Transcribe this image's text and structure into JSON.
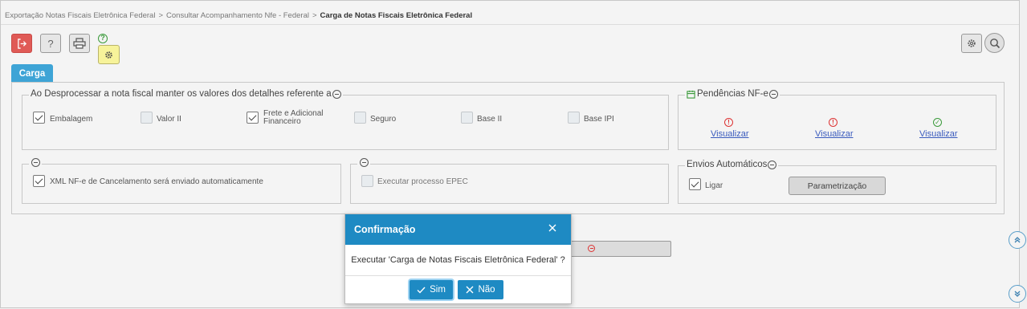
{
  "breadcrumb": {
    "items": [
      "Exportação Notas Fiscais Eletrônica Federal",
      "Consultar Acompanhamento Nfe - Federal"
    ],
    "current": "Carga de Notas Fiscais Eletrônica Federal",
    "separator": ">"
  },
  "toolbar": {
    "exit_icon": "exit-icon",
    "help_label": "?",
    "print_icon": "printer-icon",
    "settings_icon": "gear-icon",
    "context_help_label": "?"
  },
  "topright": {
    "settings_icon": "gear-icon",
    "search_icon": "search-icon"
  },
  "tab": {
    "label": "Carga"
  },
  "desprocessar": {
    "legend": "Ao Desprocessar a nota fiscal manter os valores dos detalhes referente a",
    "options": [
      {
        "label": "Embalagem",
        "checked": true
      },
      {
        "label": "Valor II",
        "checked": false
      },
      {
        "label_line1": "Frete e Adicional",
        "label_line2": "Financeiro",
        "checked": true
      },
      {
        "label": "Seguro",
        "checked": false
      },
      {
        "label": "Base II",
        "checked": false
      },
      {
        "label": "Base IPI",
        "checked": false
      }
    ]
  },
  "pendencias": {
    "legend": "Pendências NF-e",
    "links": [
      {
        "label": "Visualizar",
        "status": "error"
      },
      {
        "label": "Visualizar",
        "status": "error"
      },
      {
        "label": "Visualizar",
        "status": "ok"
      }
    ]
  },
  "xml": {
    "label": "XML NF-e de Cancelamento será enviado automaticamente",
    "checked": true
  },
  "epec": {
    "label": "Executar processo EPEC",
    "checked": false
  },
  "envios": {
    "legend": "Envios Automáticos",
    "ligar_label": "Ligar",
    "ligar_checked": true,
    "param_label": "Parametrização"
  },
  "modal": {
    "title": "Confirmação",
    "message": "Executar 'Carga de Notas Fiscais Eletrônica Federal' ?",
    "yes_label": "Sim",
    "no_label": "Não"
  },
  "colors": {
    "primary": "#1e8ac3",
    "tab": "#3ea4d6",
    "exit": "#e05a56",
    "error": "#dd3333",
    "ok": "#3a9a3a"
  }
}
